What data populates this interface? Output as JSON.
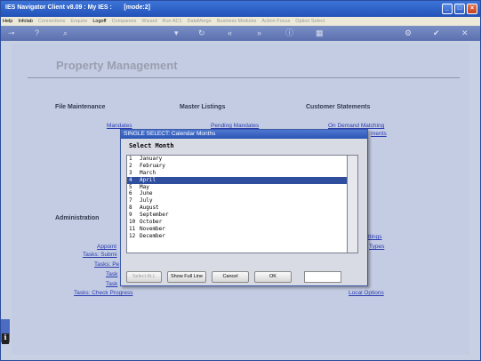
{
  "window": {
    "title": "IES Navigator Client v8.09 : My IES :       [mode:2]"
  },
  "menubar": [
    "Help",
    "Infolab",
    "Connections",
    "Enquire",
    "Logoff",
    "Companies",
    "Wizard",
    "Run AC1",
    "DataMerge",
    "Business Modules",
    "Action Focus",
    "Option Select"
  ],
  "toolbar_icons": [
    "key-icon",
    "help-icon",
    "search-icon",
    "arrow-down-icon",
    "refresh-icon",
    "back-icon",
    "forward-icon",
    "info-icon",
    "grid-icon",
    "settings-icon",
    "check-icon",
    "close-icon"
  ],
  "page": {
    "title": "Property Management"
  },
  "sections": {
    "file_maintenance": "File Maintenance",
    "master_listings": "Master Listings",
    "customer_statements": "Customer Statements",
    "administration": "Administration"
  },
  "links": {
    "mandates": "Mandates",
    "pending_mandates": "Pending Mandates",
    "on_demand_matching": "On Demand Matching",
    "statements": "ments",
    "settings": "ttings",
    "types": "Types",
    "appointments": "Appoint",
    "tasks_submit": "Tasks: Submi",
    "tasks_pe": "Tasks: Pe",
    "tasks_a": "Task",
    "tasks_b": "Task",
    "tasks_check_progress": "Tasks: Check Progress",
    "local_options": "Local Options"
  },
  "dialog": {
    "title": "SINGLE SELECT: Calendar Months",
    "heading": "Select Month",
    "items": [
      {
        "num": "1",
        "label": "January"
      },
      {
        "num": "2",
        "label": "February"
      },
      {
        "num": "3",
        "label": "March"
      },
      {
        "num": "4",
        "label": "April"
      },
      {
        "num": "5",
        "label": "May"
      },
      {
        "num": "6",
        "label": "June"
      },
      {
        "num": "7",
        "label": "July"
      },
      {
        "num": "8",
        "label": "August"
      },
      {
        "num": "9",
        "label": "September"
      },
      {
        "num": "10",
        "label": "October"
      },
      {
        "num": "11",
        "label": "November"
      },
      {
        "num": "12",
        "label": "December"
      }
    ],
    "selected_index": 3,
    "buttons": {
      "select_all": "Select ALL",
      "show_full_line": "Show Full Line",
      "cancel": "Cancel",
      "ok": "OK"
    }
  },
  "colors": {
    "selection": "#2f4f9e",
    "titlebar": "#2352b8",
    "link": "#2a3cb0"
  }
}
